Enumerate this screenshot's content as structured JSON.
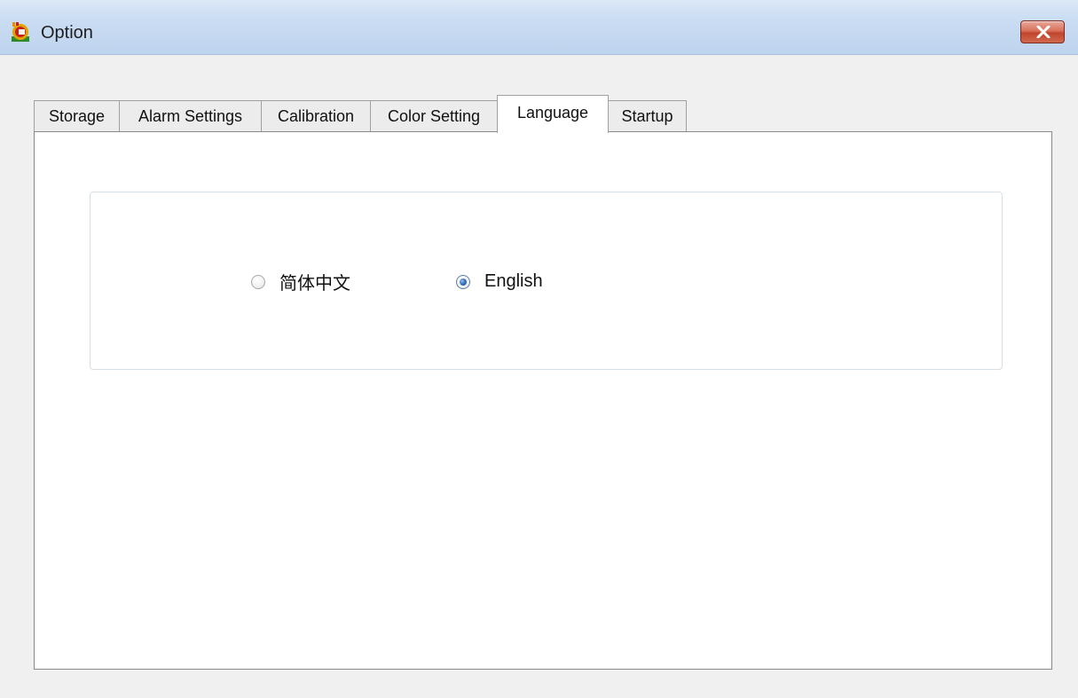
{
  "window": {
    "title": "Option",
    "icon": "app-logo-icon",
    "close_icon": "close-icon"
  },
  "tabs": [
    {
      "label": "Storage",
      "active": false
    },
    {
      "label": "Alarm Settings",
      "active": false
    },
    {
      "label": "Calibration",
      "active": false
    },
    {
      "label": "Color Setting",
      "active": false
    },
    {
      "label": "Language",
      "active": true
    },
    {
      "label": "Startup",
      "active": false
    }
  ],
  "language": {
    "options": [
      {
        "label": "简体中文",
        "selected": false
      },
      {
        "label": "English",
        "selected": true
      }
    ]
  },
  "colors": {
    "titlebar": "#c9dcf2",
    "close_button": "#c1442c",
    "panel": "#ffffff",
    "window": "#f0f0f0"
  }
}
